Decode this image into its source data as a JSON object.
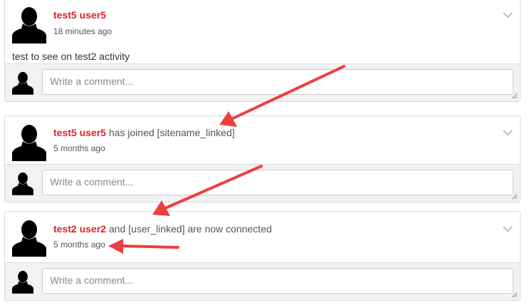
{
  "placeholder_avatar_icon": "user-silhouette-icon",
  "colors": {
    "name_red": "#d8232a",
    "annotation_red": "#ee3e3e",
    "comment_bar_bg": "#f2f2f2",
    "card_border": "#d9d9d9"
  },
  "posts": [
    {
      "author": "test5 user5",
      "action": "",
      "time": "18 minutes ago",
      "body": "test to see on test2 activity",
      "comment_placeholder": "Write a comment..."
    },
    {
      "author": "test5 user5",
      "action": "has joined [sitename_linked]",
      "time": "5 months ago",
      "comment_placeholder": "Write a comment..."
    },
    {
      "author": "test2 user2",
      "action": "and [user_linked] are now connected",
      "time": "5 months ago",
      "comment_placeholder": "Write a comment..."
    }
  ]
}
